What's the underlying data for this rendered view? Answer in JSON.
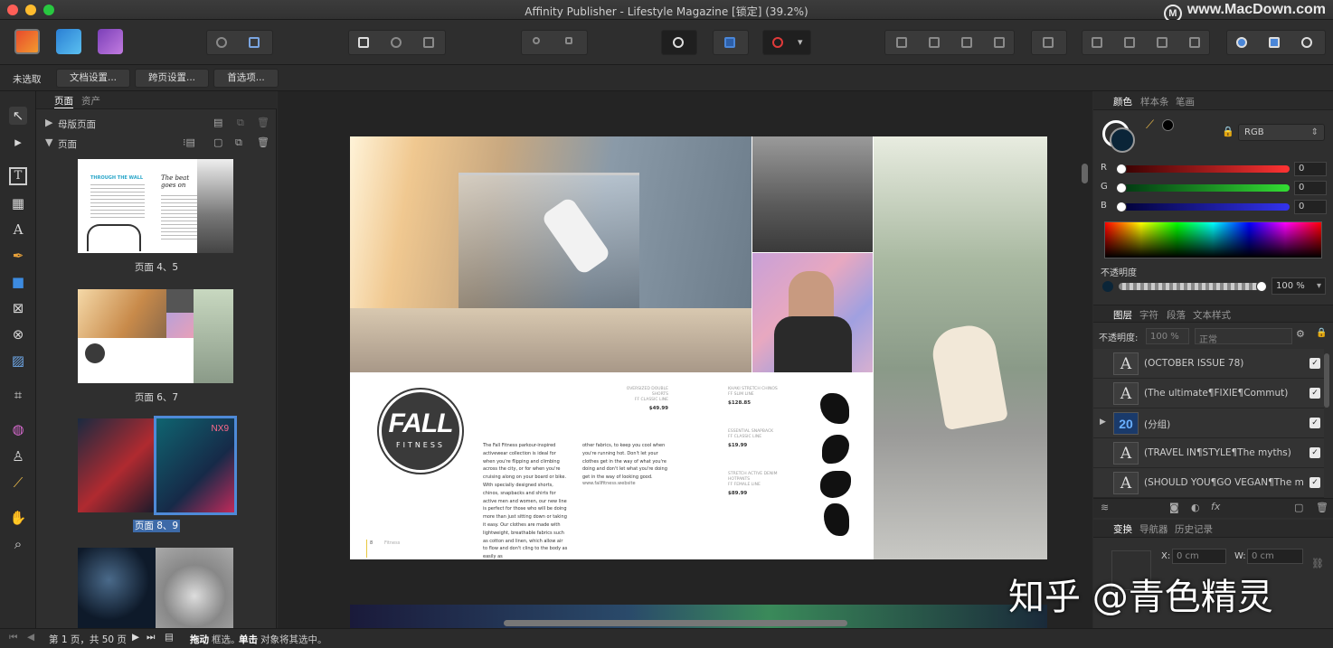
{
  "window": {
    "title": "Affinity Publisher - Lifestyle Magazine [锁定] (39.2%)"
  },
  "watermark": {
    "site": "www.MacDown.com",
    "logo_letter": "M",
    "overlay": "知乎 @青色精灵"
  },
  "context_bar": {
    "selection": "未选取",
    "buttons": [
      "文档设置...",
      "跨页设置...",
      "首选项..."
    ]
  },
  "pages_panel": {
    "tabs": [
      "页面",
      "资产"
    ],
    "master_pages": "母版页面",
    "pages": "页面",
    "thumbnails": [
      {
        "label": "页面 4、5",
        "heading_left": "THROUGH THE WALL",
        "heading_right": "The beat goes on"
      },
      {
        "label": "页面 6、7"
      },
      {
        "label": "页面 8、9",
        "badge": "NX9",
        "selected": true
      },
      {
        "label": ""
      }
    ]
  },
  "spread": {
    "logo_top": "FALL",
    "logo_bottom": "FITNESS",
    "body_text": "The Fall Fitness parkour-inspired activewear collection is ideal for when you're flipping and climbing across the city, or for when you're cruising along on your board or bike. With specially designed shorts, chinos, snapbacks and shirts for active men and women, our new line is perfect for those who will be doing more than just sitting down or taking it easy. Our clothes are made with lightweight, breathable fabrics such as cotton and linen, which allow air to flow and don't cling to the body as easily as",
    "body_text2": "other fabrics, to keep you cool when you're running hot. Don't let your clothes get in the way of what you're doing and don't let what you're doing get in the way of looking good.",
    "website": "www.fallfitness.website",
    "products": [
      {
        "name": "OVERSIZED DOUBLE SHORTS",
        "line": "FF CLASSIC LINE",
        "price": "$49.99"
      },
      {
        "name": "KHAKI STRETCH CHINOS",
        "line": "FF SLIM LINE",
        "price": "$128.85"
      },
      {
        "name": "ESSENTIAL SNAPBACK",
        "line": "FF CLASSIC LINE",
        "price": "$19.99"
      },
      {
        "name": "STRETCH ACTIVE DENIM HOTPANTS",
        "line": "FF FEMALE LINE",
        "price": "$89.99"
      }
    ],
    "page_number": "8",
    "page_footer": "Fitness"
  },
  "color_panel": {
    "tabs": [
      "颜色",
      "样本条",
      "笔画"
    ],
    "mode": "RGB",
    "channels": [
      {
        "name": "R",
        "value": "0"
      },
      {
        "name": "G",
        "value": "0"
      },
      {
        "name": "B",
        "value": "0"
      }
    ],
    "opacity_label": "不透明度",
    "opacity_value": "100 %",
    "fill_color": "#0b2538"
  },
  "layers_panel": {
    "tabs": [
      "图层",
      "字符",
      "段落",
      "文本样式"
    ],
    "opacity_label": "不透明度:",
    "opacity_value": "100 %",
    "blend_mode": "正常",
    "layers": [
      {
        "icon": "A",
        "name": "(OCTOBER ISSUE 78)"
      },
      {
        "icon": "A",
        "name": "(The ultimate¶FIXIE¶Commut)"
      },
      {
        "icon": "20",
        "name": "(分组)"
      },
      {
        "icon": "A",
        "name": "(TRAVEL IN¶STYLE¶The myths)"
      },
      {
        "icon": "A",
        "name": "(SHOULD YOU¶GO VEGAN¶The m"
      }
    ]
  },
  "transform_panel": {
    "tabs": [
      "变换",
      "导航器",
      "历史记录"
    ],
    "x_label": "X:",
    "x_value": "0 cm",
    "w_label": "W:",
    "w_value": "0 cm"
  },
  "status_bar": {
    "page_info": "第 1 页，共 50 页",
    "hint_drag": "拖动",
    "hint_drag_desc": "框选。",
    "hint_click": "单击",
    "hint_click_desc": "对象将其选中。"
  }
}
